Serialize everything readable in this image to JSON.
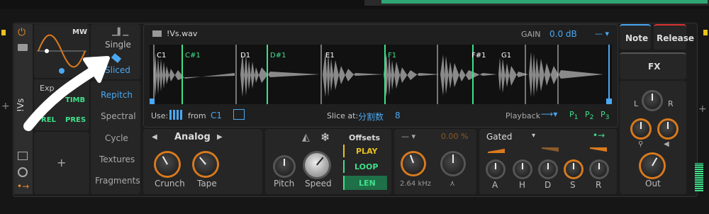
{
  "top_tabs": {
    "right_fill": ""
  },
  "modulator": {
    "title": "MW",
    "expr_label": "Exp",
    "timb": "TIMB",
    "rel": "REL",
    "pres": "PRES"
  },
  "mode": {
    "single": "Single",
    "sliced": "Sliced",
    "selected": "Sliced"
  },
  "sample_tabs": [
    "Repitch",
    "Spectral",
    "Cycle",
    "Textures",
    "Fragments"
  ],
  "device_label": "!Vs",
  "wave": {
    "filename": "!Vs.wav",
    "gain_label": "GAIN",
    "gain_value": "0.0 dB",
    "slices": [
      "C1",
      "C#1",
      "D1",
      "D#1",
      "E1",
      "F1",
      "F#1",
      "G1"
    ],
    "use_label": "Use:",
    "from_label": "from",
    "from_value": "C1",
    "slice_at_label": "Slice at:",
    "slice_at_value": "分割数",
    "slice_count": "8",
    "playback_label": "Playback",
    "p1": "P",
    "p1s": "1",
    "p2": "P",
    "p2s": "2",
    "p3": "P",
    "p3s": "3"
  },
  "analog": {
    "title": "Analog",
    "crunch": "Crunch",
    "tape": "Tape"
  },
  "pitchspeed": {
    "pitch": "Pitch",
    "speed": "Speed",
    "offsets": "Offsets",
    "play": "PLAY",
    "loop": "LOOP",
    "len": "LEN"
  },
  "filter": {
    "percent": "0.00 %",
    "freq": "2.64 kHz"
  },
  "env": {
    "mode": "Gated",
    "a": "A",
    "h": "H",
    "d": "D",
    "s": "S",
    "r": "R"
  },
  "right": {
    "note": "Note",
    "release": "Release",
    "fx": "FX",
    "l": "L",
    "r": "R",
    "out": "Out"
  },
  "colors": {
    "accent": "#4aa8f2",
    "green": "#3fe08a",
    "orange": "#d97a1e",
    "red": "#d33"
  }
}
